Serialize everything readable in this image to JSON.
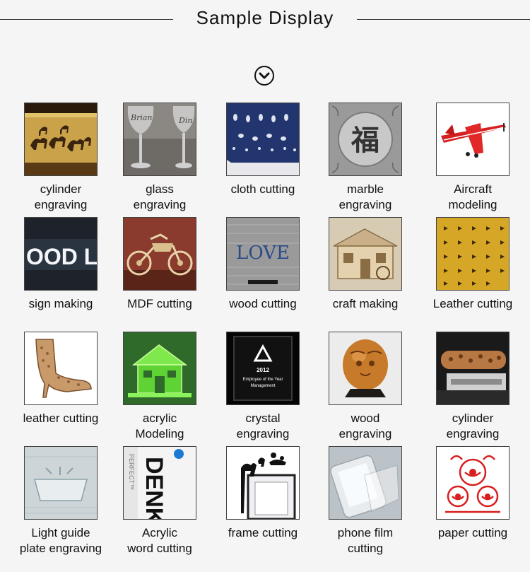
{
  "header": {
    "title": "Sample Display"
  },
  "thumb_text": {
    "glass": "Brian",
    "glass2": "Din",
    "marble": "福",
    "sign": "OOD LIFE",
    "love": "LOVE",
    "crystal_year": "2012",
    "crystal_award": "Employee of the Year",
    "crystal_sub": "Management",
    "acrylic_word": "DENKE",
    "acrylic_word2": "PERFECT™"
  },
  "samples": [
    {
      "label": "cylinder\nengraving"
    },
    {
      "label": "glass\nengraving"
    },
    {
      "label": "cloth cutting"
    },
    {
      "label": "marble\nengraving"
    },
    {
      "label": "Aircraft\nmodeling"
    },
    {
      "label": "sign making"
    },
    {
      "label": "MDF cutting"
    },
    {
      "label": "wood cutting"
    },
    {
      "label": "craft making"
    },
    {
      "label": "Leather cutting"
    },
    {
      "label": "leather  cutting"
    },
    {
      "label": "acrylic\nModeling"
    },
    {
      "label": "crystal\nengraving"
    },
    {
      "label": "wood\nengraving"
    },
    {
      "label": "cylinder\nengraving"
    },
    {
      "label": "Light guide\nplate engraving"
    },
    {
      "label": "Acrylic\nword cutting"
    },
    {
      "label": "frame cutting"
    },
    {
      "label": "phone film\ncutting"
    },
    {
      "label": "paper cutting"
    }
  ]
}
